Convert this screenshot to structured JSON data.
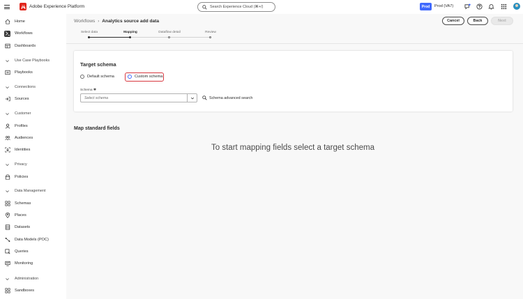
{
  "app": {
    "title": "Adobe Experience Platform"
  },
  "search": {
    "placeholder": "Search Experience Cloud (⌘+/)"
  },
  "org": {
    "badge": "Prod",
    "name": "Prod (VA7)"
  },
  "sidebar": {
    "items": [
      {
        "label": "Home",
        "icon": "home-icon"
      },
      {
        "label": "Workflows",
        "icon": "workflows-icon",
        "active": true
      },
      {
        "label": "Dashboards",
        "icon": "dashboards-icon"
      },
      {
        "group": "Use Case Playbooks"
      },
      {
        "label": "Playbooks",
        "icon": "playbooks-icon"
      },
      {
        "group": "Connections"
      },
      {
        "label": "Sources",
        "icon": "sources-icon"
      },
      {
        "group": "Customer"
      },
      {
        "label": "Profiles",
        "icon": "profiles-icon"
      },
      {
        "label": "Audiences",
        "icon": "audiences-icon"
      },
      {
        "label": "Identities",
        "icon": "identities-icon"
      },
      {
        "group": "Privacy"
      },
      {
        "label": "Policies",
        "icon": "policies-icon"
      },
      {
        "group": "Data Management"
      },
      {
        "label": "Schemas",
        "icon": "schemas-icon"
      },
      {
        "label": "Places",
        "icon": "places-icon"
      },
      {
        "label": "Datasets",
        "icon": "datasets-icon"
      },
      {
        "label": "Data Models (POC)",
        "icon": "data-models-icon"
      },
      {
        "label": "Queries",
        "icon": "queries-icon"
      },
      {
        "label": "Monitoring",
        "icon": "monitoring-icon"
      },
      {
        "group": "Administration"
      },
      {
        "label": "Sandboxes",
        "icon": "sandboxes-icon"
      }
    ]
  },
  "breadcrumb": {
    "parent": "Workflows",
    "separator": "›",
    "current": "Analytics source add data"
  },
  "actions": {
    "cancel": "Cancel",
    "back": "Back",
    "next": "Next"
  },
  "steps": [
    {
      "label": "Select data",
      "state": "done"
    },
    {
      "label": "Mapping",
      "state": "current"
    },
    {
      "label": "Dataflow detail",
      "state": "todo"
    },
    {
      "label": "Review",
      "state": "todo"
    }
  ],
  "target_schema": {
    "title": "Target schema",
    "options": [
      {
        "label": "Default schema",
        "selected": false
      },
      {
        "label": "Custom schema",
        "selected": true
      }
    ],
    "field_label": "Schema ✱",
    "select_placeholder": "Select schema",
    "advanced_search": "Schema advanced search"
  },
  "mapping": {
    "heading": "Map standard fields",
    "empty_message": "To start mapping fields select a target schema"
  },
  "colors": {
    "accent": "#4069fd",
    "highlight": "#d7373f",
    "logo": "#e1251b"
  }
}
